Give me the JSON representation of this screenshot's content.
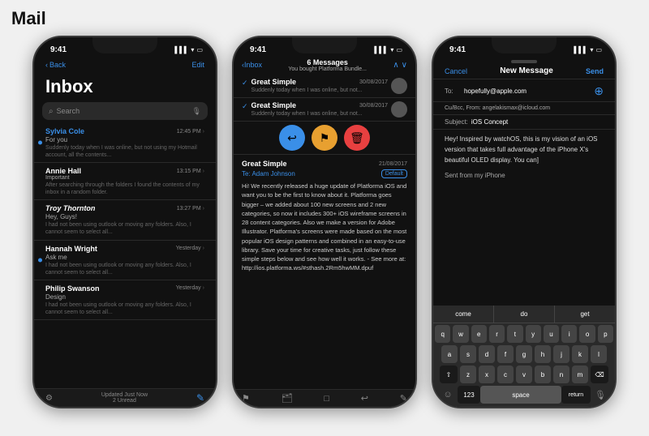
{
  "page": {
    "title": "Mail"
  },
  "phone1": {
    "status_time": "9:41",
    "nav_back": "Back",
    "nav_edit": "Edit",
    "inbox_title": "Inbox",
    "search_placeholder": "Search",
    "emails": [
      {
        "sender": "Sylvia Cole",
        "time": "12:45 PM",
        "subject": "For you",
        "preview": "Suddenly today when I was online, but not using my Hotmail account, all the contents...",
        "unread": true
      },
      {
        "sender": "Annie Hall",
        "label": "Important",
        "time": "13:15 PM",
        "preview": "After searching through the folders I found the contents of my inbox in a random folder.",
        "unread": false
      },
      {
        "sender": "Troy Thornton",
        "time": "13:27 PM",
        "subject": "Hey, Guys!",
        "preview": "I had not been using outlook or moving any folders. Also, I cannot seem to select all...",
        "unread": false
      },
      {
        "sender": "Hannah Wright",
        "time": "Yesterday",
        "subject": "Ask me",
        "preview": "I had not been using outlook or moving any folders. Also, I cannot seem to select all...",
        "unread": true
      },
      {
        "sender": "Philip Swanson",
        "time": "Yesterday",
        "subject": "Design",
        "preview": "I had not been using outlook or moving any folders. Also, I cannot seem to select all...",
        "unread": false
      }
    ],
    "footer_updated": "Updated Just Now",
    "footer_unread": "2 Unread"
  },
  "phone2": {
    "status_time": "9:41",
    "nav_back": "Inbox",
    "thread_count": "6 Messages",
    "thread_subtitle": "You bought Platforma Bundle...",
    "messages": [
      {
        "sender": "Great Simple",
        "date": "30/08/2017",
        "preview": "Suddenly today when I was online, but not...",
        "checked": true
      },
      {
        "sender": "Great Simple",
        "date": "30/08/2017",
        "preview": "Suddenly today when I was online, but not...",
        "checked": true
      }
    ],
    "full_email": {
      "from": "Great Simple",
      "to": "Te: Adam Johnson",
      "date": "21/08/2017",
      "label": "Default",
      "body": "Hi! We recently released a huge update of Platforma iOS and want you to be the first to know about it. Platforma goes bigger – we added about 100 new screens and 2 new categories, so now it includes 300+ iOS wireframe screens in 28 content categories. Also we make a version for Adobe Illustrator.\nPlatforma's screens were made based on the most popular iOS design patterns and combined in an easy-to-use library. Save your time for creative tasks, just follow these simple steps below and see how well it works. - See more at: http://ios.platforma.ws/#sthash.2Rm5hwMM.dpuf"
    }
  },
  "phone3": {
    "status_time": "9:41",
    "nav_cancel": "Cancel",
    "nav_title": "New Message",
    "nav_send": "Send",
    "to_value": "hopefully@apple.com",
    "cc_bcc_value": "Cu/Bcc, From: angelakismax@icloud.com",
    "subject_value": "iOS Concept",
    "body": "Hey!\n\nInspired by watchOS, this is my vision of an iOS version that takes full advantage of the iPhone X's beautiful OLED display. You can]",
    "signature": "Sent from my iPhone",
    "keyboard": {
      "suggestions": [
        "come",
        "do",
        "get"
      ],
      "row1": [
        "q",
        "w",
        "e",
        "r",
        "t",
        "y",
        "u",
        "i",
        "o",
        "p"
      ],
      "row2": [
        "a",
        "s",
        "d",
        "f",
        "g",
        "h",
        "j",
        "k",
        "l"
      ],
      "row3": [
        "z",
        "x",
        "c",
        "v",
        "b",
        "n",
        "m"
      ],
      "num_label": "123",
      "space_label": "space",
      "return_label": "return"
    }
  }
}
